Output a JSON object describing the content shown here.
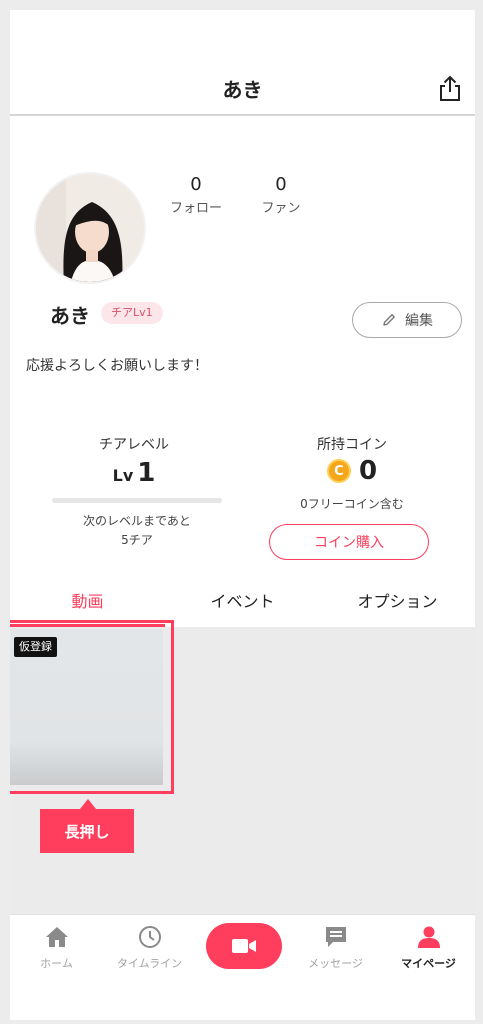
{
  "header": {
    "title": "あき",
    "share_icon": "share-icon"
  },
  "profile": {
    "name": "あき",
    "level_badge": "チアLv1",
    "follow_count": "0",
    "follow_label": "フォロー",
    "fan_count": "0",
    "fan_label": "ファン",
    "edit_label": "編集",
    "bio": "応援よろしくお願いします！"
  },
  "cheer": {
    "label": "チアレベル",
    "lv_prefix": "Lv",
    "level": "1",
    "progress_fraction": 0.0,
    "next_line1": "次のレベルまであと",
    "next_line2": "5チア"
  },
  "coins": {
    "label": "所持コイン",
    "icon_letter": "C",
    "value": "0",
    "note": "0フリーコイン含む",
    "buy_label": "コイン購入"
  },
  "tabs": [
    {
      "label": "動画",
      "active": true
    },
    {
      "label": "イベント",
      "active": false
    },
    {
      "label": "オプション",
      "active": false
    }
  ],
  "video": {
    "badge": "仮登録"
  },
  "tooltip": {
    "label": "長押し"
  },
  "nav": [
    {
      "label": "ホーム",
      "icon": "home-icon"
    },
    {
      "label": "タイムライン",
      "icon": "clock-icon"
    },
    {
      "label": "",
      "icon": "video-camera-icon"
    },
    {
      "label": "メッセージ",
      "icon": "message-icon"
    },
    {
      "label": "マイページ",
      "icon": "person-icon",
      "active": true
    }
  ],
  "colors": {
    "accent": "#ff3d5c",
    "coin": "#f5a71b"
  }
}
